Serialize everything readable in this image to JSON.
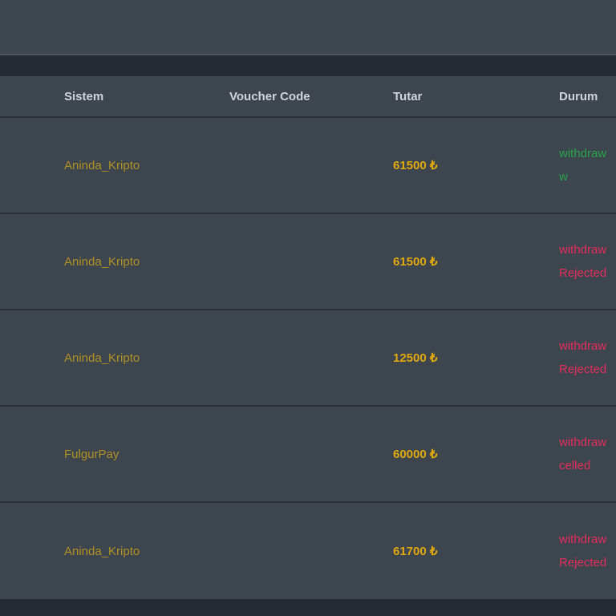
{
  "palette": {
    "page_background": "#262b33",
    "surface": "#3d454e",
    "topbar": "#3e4650",
    "topbar_edge": "#4c5560",
    "row_divider": "#2a3039",
    "header_text": "#d0d4da",
    "system_text_gold": "#b19125",
    "amount_text_gold": "#e1a90e",
    "status_green": "#2aa34c",
    "status_red": "#e52d5b"
  },
  "table": {
    "columns": [
      "Sistem",
      "Voucher Code",
      "Tutar",
      "Durum"
    ],
    "currency_symbol": "₺",
    "rows": [
      {
        "system": "Aninda_Kripto",
        "voucher_code": "",
        "amount": "61500",
        "status_lines": [
          "withdraw",
          "w"
        ],
        "status_color": "green"
      },
      {
        "system": "Aninda_Kripto",
        "voucher_code": "",
        "amount": "61500",
        "status_lines": [
          "withdraw",
          "Rejected"
        ],
        "status_color": "red"
      },
      {
        "system": "Aninda_Kripto",
        "voucher_code": "",
        "amount": "12500",
        "status_lines": [
          "withdraw",
          "Rejected"
        ],
        "status_color": "red"
      },
      {
        "system": "FulgurPay",
        "voucher_code": "",
        "amount": "60000",
        "status_lines": [
          "withdraw",
          "celled"
        ],
        "status_color": "red"
      },
      {
        "system": "Aninda_Kripto",
        "voucher_code": "",
        "amount": "61700",
        "status_lines": [
          "withdraw",
          "Rejected"
        ],
        "status_color": "red"
      }
    ]
  }
}
